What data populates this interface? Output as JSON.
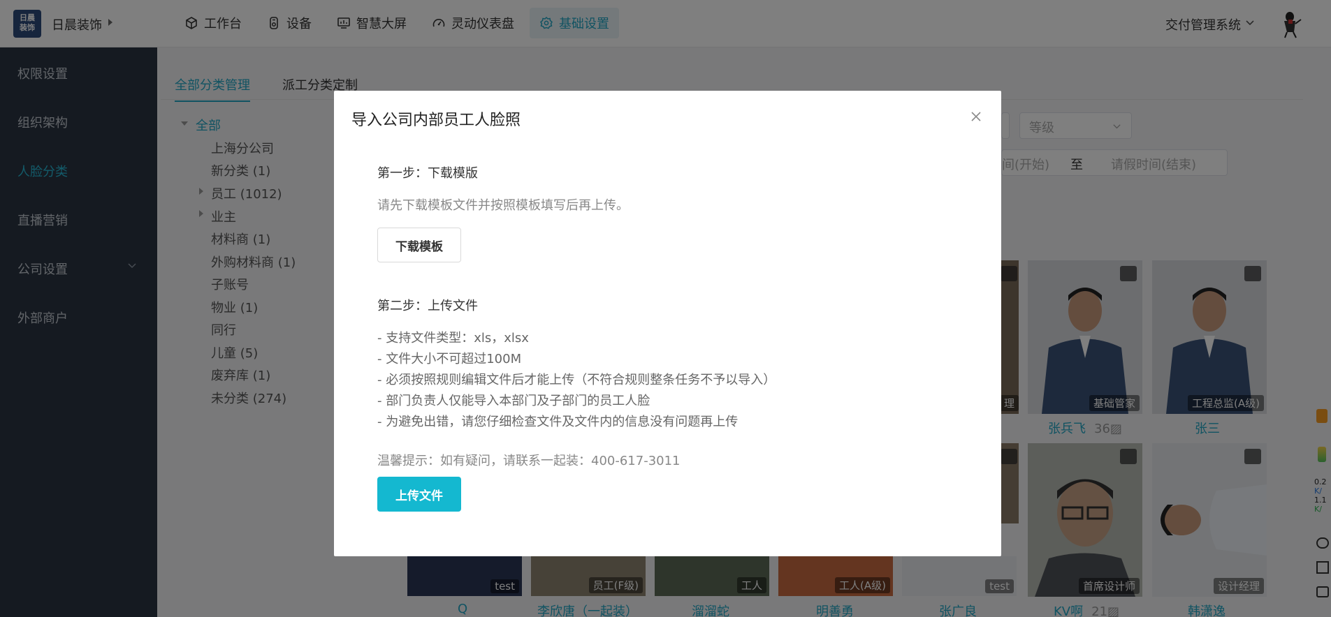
{
  "header": {
    "logo_text": "日晨装饰",
    "brand": "日晨装饰",
    "nav": [
      {
        "label": "工作台",
        "icon": "cube-icon"
      },
      {
        "label": "设备",
        "icon": "device-icon"
      },
      {
        "label": "智慧大屏",
        "icon": "monitor-icon"
      },
      {
        "label": "灵动仪表盘",
        "icon": "gauge-icon"
      },
      {
        "label": "基础设置",
        "icon": "gear-icon",
        "active": true
      }
    ],
    "system": "交付管理系统"
  },
  "sidebar": {
    "items": [
      {
        "label": "权限设置"
      },
      {
        "label": "组织架构"
      },
      {
        "label": "人脸分类",
        "active": true
      },
      {
        "label": "直播营销"
      },
      {
        "label": "公司设置"
      },
      {
        "label": "外部商户"
      }
    ]
  },
  "main": {
    "tabs": [
      {
        "label": "全部分类管理",
        "active": true
      },
      {
        "label": "派工分类定制"
      }
    ],
    "tree": [
      {
        "label": "全部",
        "active": true
      },
      {
        "label": "上海分公司"
      },
      {
        "label": "新分类 (1)"
      },
      {
        "label": "员工 (1012)"
      },
      {
        "label": "业主"
      },
      {
        "label": "材料商 (1)"
      },
      {
        "label": "外购材料商 (1)"
      },
      {
        "label": "子账号"
      },
      {
        "label": "物业 (1)"
      },
      {
        "label": "同行"
      },
      {
        "label": "儿童 (5)"
      },
      {
        "label": "废弃库 (1)"
      },
      {
        "label": "未分类 (274)"
      }
    ],
    "filters": {
      "level_placeholder": "等级",
      "leave_start": "间(开始)",
      "to": "至",
      "leave_end": "请假时间(结束)"
    },
    "cards_top": [
      {
        "badge": "理",
        "name": ""
      },
      {
        "badge": "基础管家",
        "name": "张兵飞",
        "count": "36"
      },
      {
        "badge": "工程总监(A级)",
        "name": "张三"
      }
    ],
    "cards_bottom": [
      {
        "badge": "test",
        "name": "Q"
      },
      {
        "badge": "员工(F级)",
        "name": "李欣唐（一起装）"
      },
      {
        "badge": "工人",
        "name": "溜溜蛇"
      },
      {
        "badge": "工人(A级)",
        "name": "明善勇"
      },
      {
        "badge": "test",
        "name": "张广良"
      },
      {
        "badge": "首席设计师",
        "name": "KV啊",
        "count": "21"
      },
      {
        "badge": "设计经理",
        "name": "韩潇逸"
      }
    ]
  },
  "modal": {
    "title": "导入公司内部员工人脸照",
    "step1_title": "第一步：下载模版",
    "step1_hint": "请先下载模板文件并按照模板填写后再上传。",
    "download_label": "下载模板",
    "step2_title": "第二步：上传文件",
    "rules": [
      "- 支持文件类型：xls，xlsx",
      "- 文件大小不可超过100M",
      "- 必须按照规则编辑文件后才能上传（不符合规则整条任务不予以导入）",
      "- 部门负责人仅能导入本部门及子部门的员工人脸",
      "- 为避免出错，请您仔细检查文件及文件内的信息没有问题再上传"
    ],
    "tip": "温馨提示：如有疑问，请联系一起装：400-617-3011",
    "upload_label": "上传文件"
  },
  "widget": {
    "up": "0.2",
    "up_unit": "K/",
    "down": "1.1",
    "down_unit": "K/"
  },
  "colors": {
    "accent": "#22a6c5",
    "primary_button": "#14b8d0",
    "sidebar_bg": "#2a3542"
  }
}
